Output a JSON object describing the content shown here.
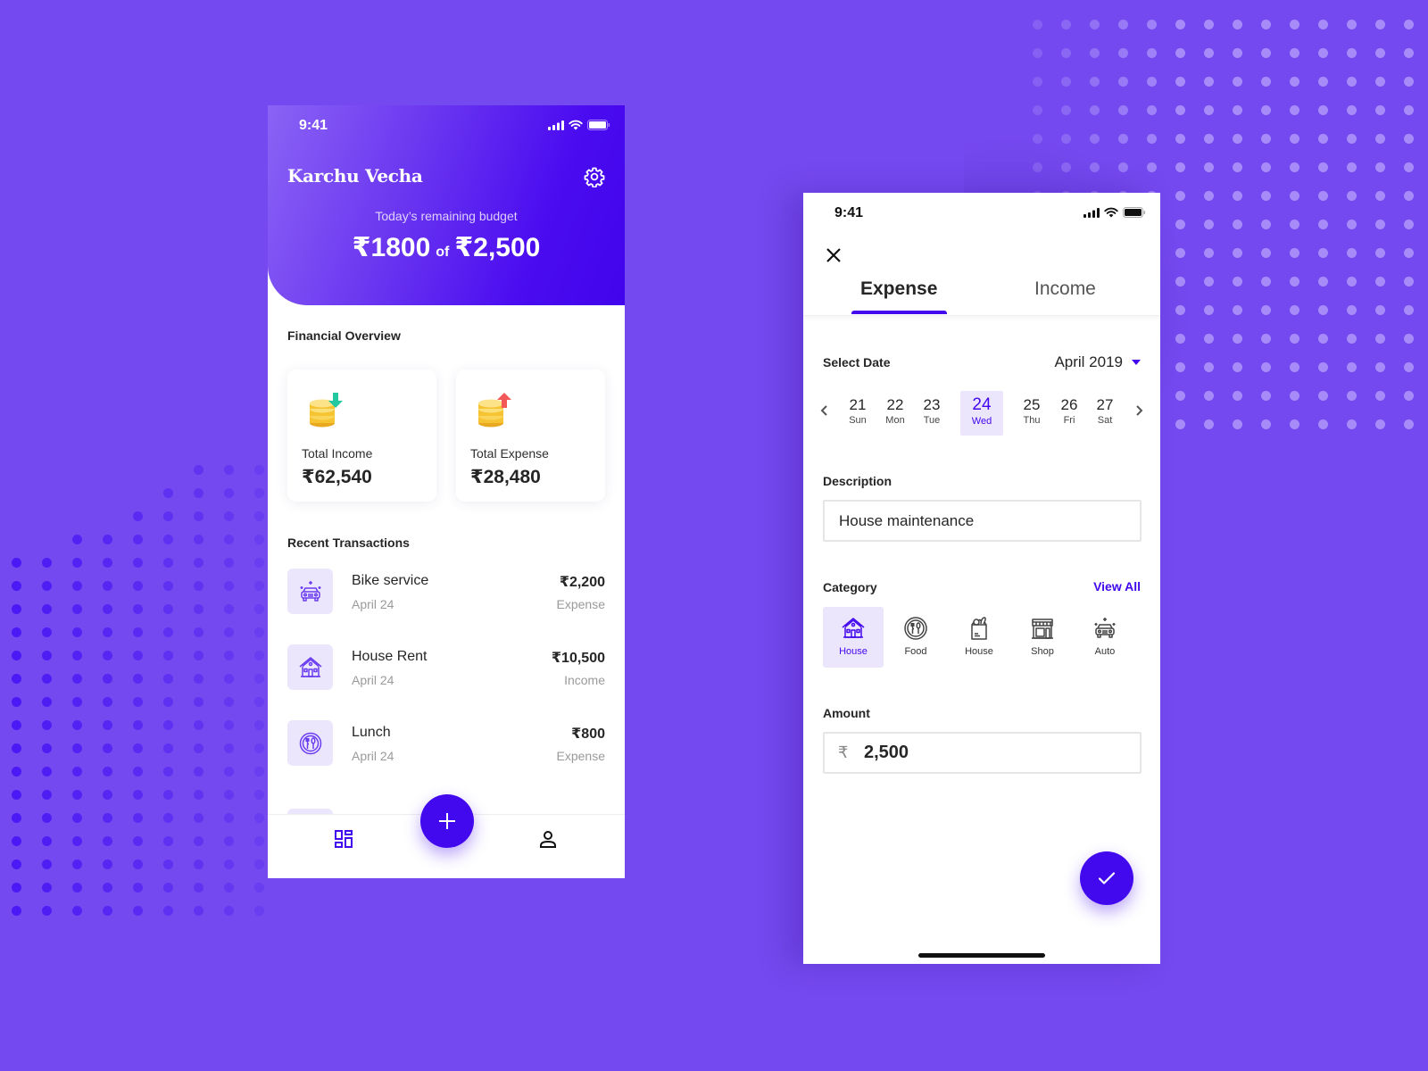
{
  "colors": {
    "background": "#7449ef",
    "accent": "#4309ee",
    "accent_light": "#ece6fd",
    "text_primary": "#262626",
    "text_muted": "#9a9a9a",
    "income_arrow": "#22c9a0",
    "expense_arrow": "#f25858",
    "coin": "#f6c433"
  },
  "home_screen": {
    "status_time": "9:41",
    "app_title": "Karchu Vecha",
    "settings_icon": "gear-icon",
    "budget": {
      "label": "Today’s remaining budget",
      "remaining": "₹1800",
      "of": "of",
      "total": "₹2,500"
    },
    "financial_overview": {
      "title": "Financial Overview",
      "cards": [
        {
          "label": "Total Income",
          "value": "₹62,540",
          "icon": "coins-arrow-down-icon"
        },
        {
          "label": "Total Expense",
          "value": "₹28,480",
          "icon": "coins-arrow-up-icon"
        }
      ]
    },
    "recent_transactions": {
      "title": "Recent Transactions",
      "items": [
        {
          "name": "Bike service",
          "date": "April 24",
          "amount": "₹2,200",
          "type": "Expense",
          "icon": "car-wash-icon"
        },
        {
          "name": "House Rent",
          "date": "April 24",
          "amount": "₹10,500",
          "type": "Income",
          "icon": "house-icon"
        },
        {
          "name": "Lunch",
          "date": "April 24",
          "amount": "₹800",
          "type": "Expense",
          "icon": "plate-cutlery-icon"
        }
      ]
    },
    "bottom_nav": {
      "dashboard_icon": "dashboard-icon",
      "add_icon": "plus-icon",
      "profile_icon": "user-icon"
    }
  },
  "add_screen": {
    "status_time": "9:41",
    "close_icon": "close-icon",
    "tabs": [
      {
        "label": "Expense",
        "active": true
      },
      {
        "label": "Income",
        "active": false
      }
    ],
    "date": {
      "label": "Select Date",
      "month": "April 2019",
      "days": [
        {
          "num": "21",
          "dow": "Sun",
          "selected": false
        },
        {
          "num": "22",
          "dow": "Mon",
          "selected": false
        },
        {
          "num": "23",
          "dow": "Tue",
          "selected": false
        },
        {
          "num": "24",
          "dow": "Wed",
          "selected": true
        },
        {
          "num": "25",
          "dow": "Thu",
          "selected": false
        },
        {
          "num": "26",
          "dow": "Fri",
          "selected": false
        },
        {
          "num": "27",
          "dow": "Sat",
          "selected": false
        }
      ]
    },
    "description": {
      "label": "Description",
      "value": "House maintenance"
    },
    "category": {
      "label": "Category",
      "view_all": "View All",
      "items": [
        {
          "label": "House",
          "icon": "house-icon",
          "selected": true
        },
        {
          "label": "Food",
          "icon": "plate-cutlery-icon",
          "selected": false
        },
        {
          "label": "House",
          "icon": "grocery-bag-icon",
          "selected": false
        },
        {
          "label": "Shop",
          "icon": "storefront-icon",
          "selected": false
        },
        {
          "label": "Auto",
          "icon": "car-wash-icon",
          "selected": false
        }
      ]
    },
    "amount": {
      "label": "Amount",
      "currency": "₹",
      "value": "2,500"
    },
    "submit_icon": "check-icon"
  }
}
